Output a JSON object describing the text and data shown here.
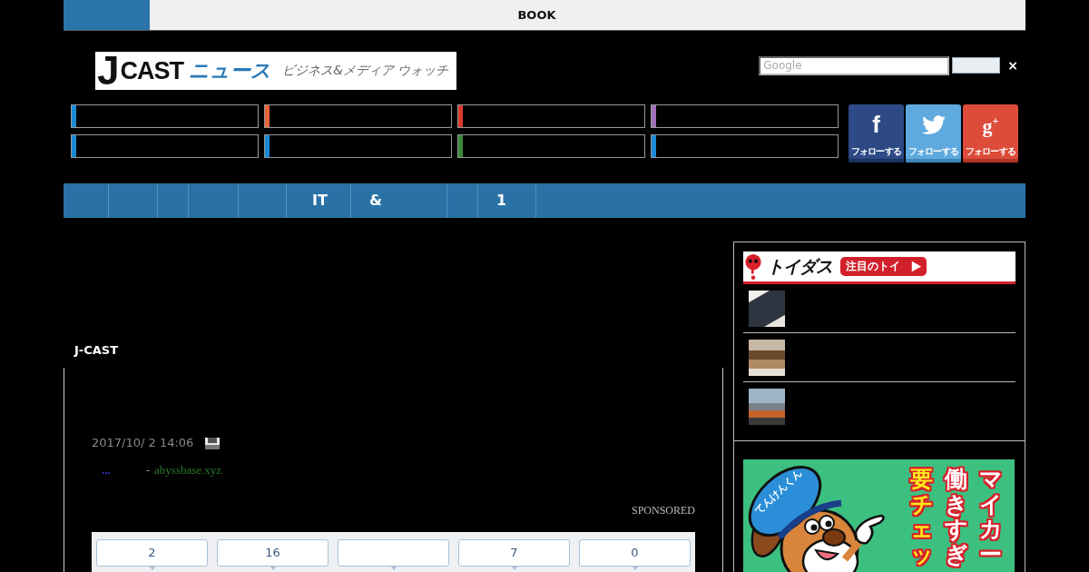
{
  "top_bar": {
    "label": "BOOK"
  },
  "logo": {
    "mark": "J",
    "brand": "CAST",
    "name": "ニュース",
    "tagline": "ビジネス&メディア ウォッチ"
  },
  "search": {
    "placeholder": "Google",
    "close": "×"
  },
  "menu": {
    "items": [
      {
        "color": "#1a8ad4"
      },
      {
        "color": "#e8643c"
      },
      {
        "color": "#d93a2b"
      },
      {
        "color": "#a070b8"
      },
      {
        "color": "#1a8ad4"
      },
      {
        "color": "#1a8ad4"
      },
      {
        "color": "#3a8a3a"
      },
      {
        "color": "#1a8ad4"
      }
    ]
  },
  "social": [
    {
      "kind": "facebook",
      "glyph": "f",
      "label": "フォローする"
    },
    {
      "kind": "twitter",
      "label": "フォローする"
    },
    {
      "kind": "googleplus",
      "glyph": "g$^{+}$",
      "label": "フォローする"
    }
  ],
  "nav": {
    "items": [
      {
        "kind": "blank"
      },
      {
        "kind": "blank"
      },
      {
        "kind": "blank"
      },
      {
        "kind": "blank"
      },
      {
        "kind": "blank"
      },
      {
        "kind": "text",
        "label": "IT"
      },
      {
        "kind": "text",
        "label": "&"
      },
      {
        "kind": "blank"
      },
      {
        "kind": "text",
        "label": "1"
      }
    ]
  },
  "section_label": "J-CAST",
  "article": {
    "date": "2017/10/ 2 14:06",
    "source": {
      "dots": "...",
      "separator": "-",
      "domain": "abyssbase.xyz"
    },
    "sponsored": "SPONSORED",
    "share_counts": [
      {
        "kind": "count",
        "value": "2"
      },
      {
        "kind": "count",
        "value": "16"
      },
      {
        "kind": "blank"
      },
      {
        "kind": "count",
        "value": "7"
      },
      {
        "kind": "count",
        "value": "0"
      }
    ]
  },
  "sidebar": {
    "toidas": {
      "logo": "トイダス",
      "badge": "注目のトイ",
      "items": [
        {
          "kind": "thumbnail"
        },
        {
          "kind": "thumbnail"
        },
        {
          "kind": "thumbnail"
        }
      ]
    },
    "ad": {
      "cap_text": "てんけんくん",
      "columns": [
        {
          "text": "要チェッ",
          "color": "#ffe81a"
        },
        {
          "text": "働きすぎ",
          "color": "#ffffff"
        },
        {
          "text": "マイカー",
          "color": "#ffffff"
        }
      ]
    }
  }
}
